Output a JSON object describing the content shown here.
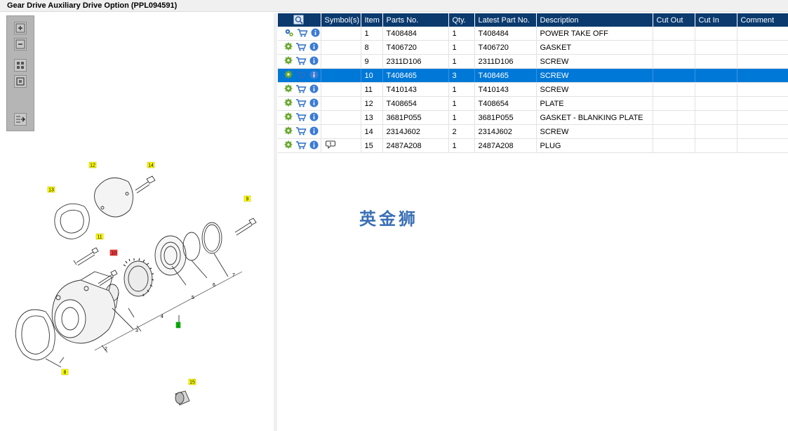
{
  "title": "Gear Drive Auxiliary Drive Option (PPL094591)",
  "toolbar": {
    "zoom_in": "zoom-in-icon",
    "zoom_out": "zoom-out-icon",
    "fit": "fit-icon",
    "actual": "actual-size-icon",
    "export": "export-icon"
  },
  "columns": [
    "",
    "Symbol(s)",
    "Item",
    "Parts No.",
    "Qty.",
    "Latest Part No.",
    "Description",
    "Cut Out",
    "Cut In",
    "Comment"
  ],
  "rows": [
    {
      "item": "1",
      "part": "T408484",
      "qty": "1",
      "latest": "T408484",
      "desc": "POWER TAKE OFF",
      "cutout": "",
      "cutin": "",
      "comment": "",
      "symbol": ""
    },
    {
      "item": "8",
      "part": "T406720",
      "qty": "1",
      "latest": "T406720",
      "desc": "GASKET",
      "cutout": "",
      "cutin": "",
      "comment": "",
      "symbol": ""
    },
    {
      "item": "9",
      "part": "2311D106",
      "qty": "1",
      "latest": "2311D106",
      "desc": "SCREW",
      "cutout": "",
      "cutin": "",
      "comment": "",
      "symbol": ""
    },
    {
      "item": "10",
      "part": "T408465",
      "qty": "3",
      "latest": "T408465",
      "desc": "SCREW",
      "cutout": "",
      "cutin": "",
      "comment": "",
      "symbol": ""
    },
    {
      "item": "11",
      "part": "T410143",
      "qty": "1",
      "latest": "T410143",
      "desc": "SCREW",
      "cutout": "",
      "cutin": "",
      "comment": "",
      "symbol": ""
    },
    {
      "item": "12",
      "part": "T408654",
      "qty": "1",
      "latest": "T408654",
      "desc": "PLATE",
      "cutout": "",
      "cutin": "",
      "comment": "",
      "symbol": ""
    },
    {
      "item": "13",
      "part": "3681P055",
      "qty": "1",
      "latest": "3681P055",
      "desc": "GASKET - BLANKING PLATE",
      "cutout": "",
      "cutin": "",
      "comment": "",
      "symbol": ""
    },
    {
      "item": "14",
      "part": "2314J602",
      "qty": "2",
      "latest": "2314J602",
      "desc": "SCREW",
      "cutout": "",
      "cutin": "",
      "comment": "",
      "symbol": ""
    },
    {
      "item": "15",
      "part": "2487A208",
      "qty": "1",
      "latest": "2487A208",
      "desc": "PLUG",
      "cutout": "",
      "cutin": "",
      "comment": "",
      "symbol": "comment-icon"
    }
  ],
  "selected_row_item": "10",
  "watermark": "英金狮",
  "callouts": {
    "c12": "12",
    "c14": "14",
    "c13": "13",
    "c9": "9",
    "c11": "11",
    "c10": "10",
    "c1": "1",
    "c2": "2",
    "c3": "3",
    "c4": "4",
    "c5": "5",
    "c6": "6",
    "c7": "7",
    "c8": "8",
    "c15": "15"
  },
  "colors": {
    "header_bg": "#0a3a6e",
    "selected_row": "#0078d7",
    "callout_yellow": "#ffff00",
    "callout_red": "#ff4444",
    "callout_green": "#00cc00"
  }
}
